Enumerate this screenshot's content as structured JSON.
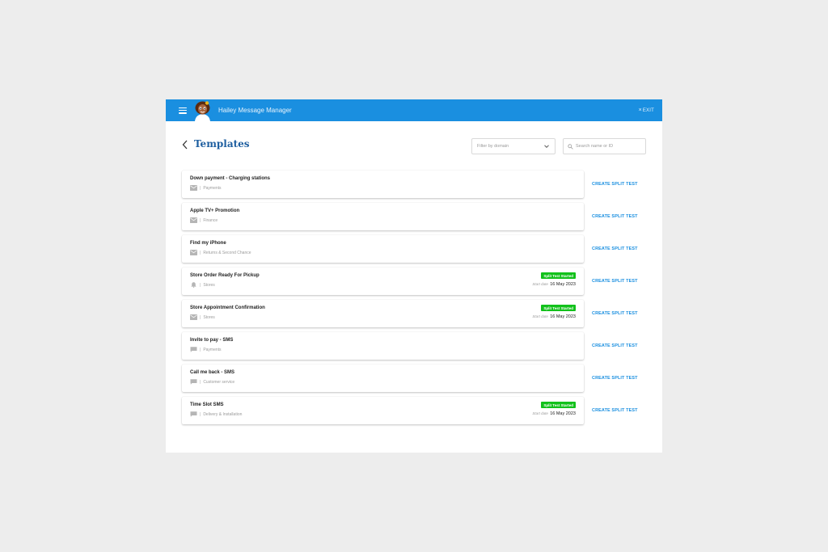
{
  "app": {
    "title": "Hailey Message Manager",
    "exit_label": "EXIT",
    "exit_icon": "×"
  },
  "page": {
    "title": "Templates",
    "filter_placeholder": "Filter by domain",
    "search_placeholder": "Search name or ID"
  },
  "templates": [
    {
      "name": "Down payment - Charging stations",
      "channel": "email",
      "domain": "Payments",
      "badge": "",
      "start_label": "",
      "start_date": "",
      "action": "CREATE SPLIT TEST"
    },
    {
      "name": "Apple TV+ Promotion",
      "channel": "email",
      "domain": "Finance",
      "badge": "",
      "start_label": "",
      "start_date": "",
      "action": "CREATE SPLIT TEST"
    },
    {
      "name": "Find my iPhone",
      "channel": "email",
      "domain": "Returns & Second Chance",
      "badge": "",
      "start_label": "",
      "start_date": "",
      "action": "CREATE SPLIT TEST"
    },
    {
      "name": "Store Order Ready For Pickup",
      "channel": "push",
      "domain": "Stores",
      "badge": "Split Test Started",
      "start_label": "Start date",
      "start_date": "16 May 2023",
      "action": "CREATE SPLIT TEST"
    },
    {
      "name": "Store Appointment Confirmation",
      "channel": "email",
      "domain": "Stores",
      "badge": "Split Test Started",
      "start_label": "Start date",
      "start_date": "16 May 2023",
      "action": "CREATE SPLIT TEST"
    },
    {
      "name": "Invite to pay - SMS",
      "channel": "sms",
      "domain": "Payments",
      "badge": "",
      "start_label": "",
      "start_date": "",
      "action": "CREATE SPLIT TEST"
    },
    {
      "name": "Call me back - SMS",
      "channel": "sms",
      "domain": "Customer service",
      "badge": "",
      "start_label": "",
      "start_date": "",
      "action": "CREATE SPLIT TEST"
    },
    {
      "name": "Time Slot SMS",
      "channel": "sms",
      "domain": "Delivery & Installation",
      "badge": "Split Test Started",
      "start_label": "Start date",
      "start_date": "16 May 2023",
      "action": "CREATE SPLIT TEST"
    }
  ],
  "colors": {
    "topbar": "#1a8fe0",
    "link": "#1a8fe0",
    "badge": "#12c11b",
    "title": "#1f5fa0"
  }
}
